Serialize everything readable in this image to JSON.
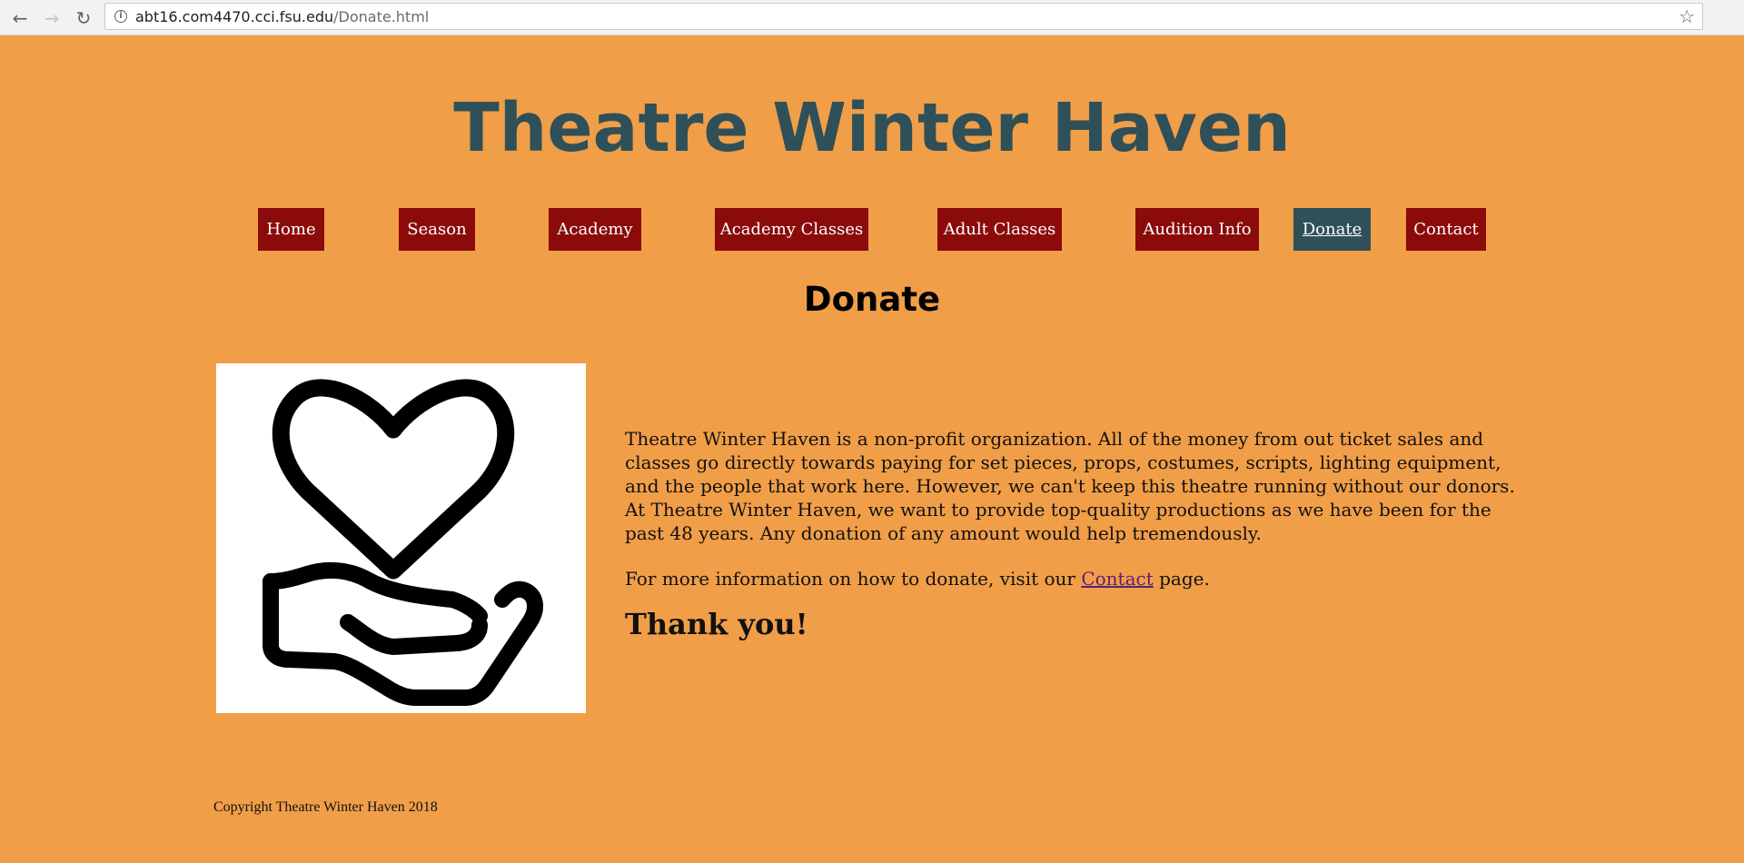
{
  "browser": {
    "back_icon": "arrow-left-icon",
    "forward_icon": "arrow-right-icon",
    "reload_icon": "reload-icon",
    "info_icon": "info-icon",
    "bookmark_icon": "star-icon",
    "url_domain": "abt16.com4470.cci.fsu.edu",
    "url_path": "/Donate.html"
  },
  "site": {
    "title": "Theatre Winter Haven"
  },
  "nav": {
    "home": "Home",
    "season": "Season",
    "academy": "Academy",
    "academy_classes": "Academy Classes",
    "adult_classes": "Adult Classes",
    "audition_info": "Audition Info",
    "donate": "Donate",
    "contact": "Contact",
    "active": "Donate"
  },
  "page": {
    "heading": "Donate",
    "image_icon": "heart-in-hand-icon",
    "paragraph1": "Theatre Winter Haven is a non-profit organization. All of the money from out ticket sales and classes go directly towards paying for set pieces, props, costumes, scripts, lighting equipment, and the people that work here. However, we can't keep this theatre running without our donors. At Theatre Winter Haven, we want to provide top-quality productions as we have been for the past 48 years. Any donation of any amount would help tremendously.",
    "paragraph2_before": "For more information on how to donate, visit our ",
    "paragraph2_link": "Contact",
    "paragraph2_after": " page.",
    "thanks": "Thank you!"
  },
  "footer": {
    "copyright": "Copyright Theatre Winter Haven 2018"
  },
  "colors": {
    "background": "#f19e48",
    "title": "#2f5058",
    "nav_bg": "#8b0b0b",
    "nav_active_bg": "#2f5058",
    "link": "#5a1e7a"
  }
}
